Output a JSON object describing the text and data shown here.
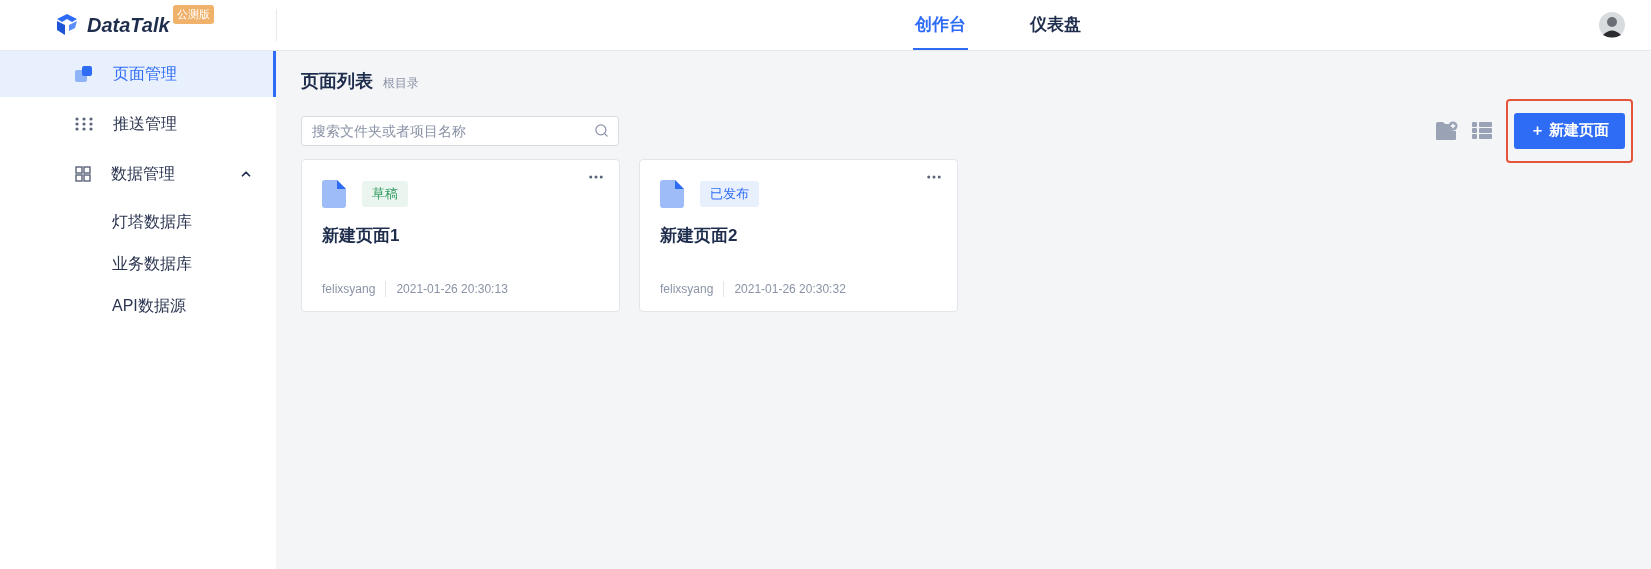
{
  "header": {
    "logo": "DataTalk",
    "badge": "公测版",
    "tabs": [
      {
        "label": "创作台",
        "selected": true
      },
      {
        "label": "仪表盘",
        "selected": false
      }
    ]
  },
  "sidebar": {
    "items": [
      {
        "label": "页面管理",
        "kind": "pages",
        "selected": true
      },
      {
        "label": "推送管理",
        "kind": "push",
        "selected": false
      },
      {
        "label": "数据管理",
        "kind": "data",
        "selected": false,
        "expanded": true,
        "children": [
          {
            "label": "灯塔数据库",
            "selected": false
          },
          {
            "label": "业务数据库",
            "selected": false
          },
          {
            "label": "API数据源",
            "selected": false
          }
        ]
      }
    ]
  },
  "content": {
    "title": "页面列表",
    "breadcrumb": "根目录",
    "search": {
      "placeholder": "搜索文件夹或者项目名称"
    },
    "new_button": {
      "icon": "＋",
      "label": "新建页面",
      "highlighted": true
    },
    "cards": [
      {
        "status": "草稿",
        "kind": "draft",
        "name": "新建页面1",
        "author": "felixsyang",
        "time": "2021-01-26 20:30:13"
      },
      {
        "status": "已发布",
        "kind": "published",
        "name": "新建页面2",
        "author": "felixsyang",
        "time": "2021-01-26 20:30:32"
      }
    ]
  }
}
